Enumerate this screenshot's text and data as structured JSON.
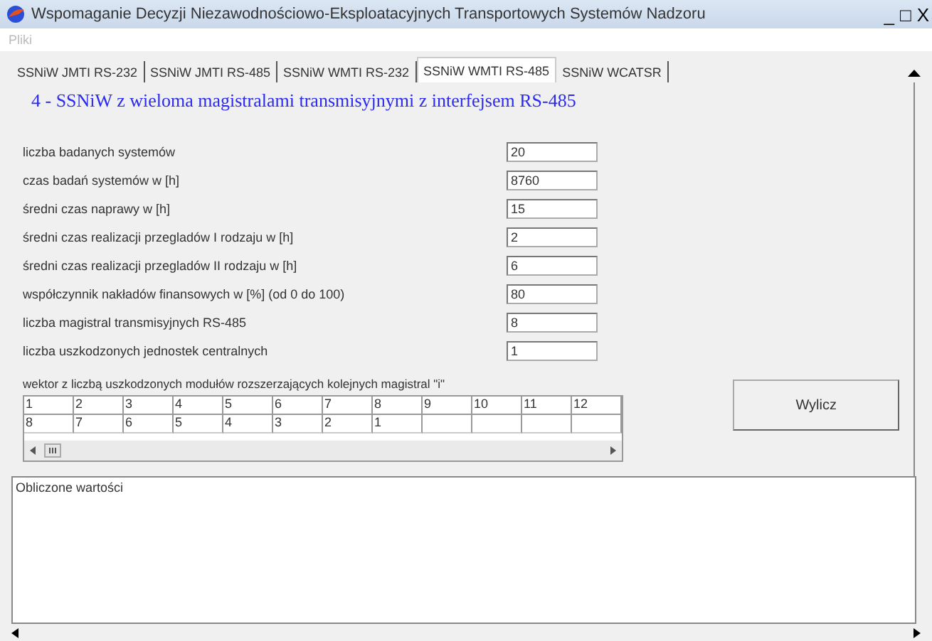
{
  "window": {
    "title": "Wspomaganie Decyzji Niezawodnościowo-Eksploatacyjnych Transportowych Systemów Nadzoru",
    "controls": [
      "_",
      "□",
      "X"
    ]
  },
  "menu": [
    {
      "label": "Pliki",
      "disabled": true
    }
  ],
  "tabs": [
    {
      "label": "SSNiW JMTI RS-232",
      "selected": false
    },
    {
      "label": "SSNiW JMTI RS-485",
      "selected": false
    },
    {
      "label": "SSNiW WMTI RS-232",
      "selected": false
    },
    {
      "label": "SSNiW WMTI RS-485",
      "selected": true
    },
    {
      "label": "SSNiW WCATSR",
      "selected": false
    }
  ],
  "heading": "4 - SSNiW z wieloma magistralami transmisyjnymi z interfejsem RS-485",
  "fields": [
    {
      "label": "liczba badanych systemów",
      "value": "20"
    },
    {
      "label": "czas badań systemów w [h]",
      "value": "8760"
    },
    {
      "label": "średni czas naprawy w [h]",
      "value": "15"
    },
    {
      "label": "średni czas realizacji przegladów I rodzaju w [h]",
      "value": "2"
    },
    {
      "label": "średni czas realizacji przegladów II rodzaju w [h]",
      "value": "6"
    },
    {
      "label": "współczynnik nakładów finansowych w [%] (od 0 do 100)",
      "value": "80"
    },
    {
      "label": "liczba magistral transmisyjnych RS-485",
      "value": "8"
    },
    {
      "label": "liczba uszkodzonych jednostek centralnych",
      "value": "1"
    }
  ],
  "vector": {
    "label": "wektor z liczbą uszkodzonych modułów rozszerzających kolejnych magistral \"i\"",
    "columns": [
      "1",
      "2",
      "3",
      "4",
      "5",
      "6",
      "7",
      "8",
      "9",
      "10",
      "11",
      "12"
    ],
    "values": [
      "8",
      "7",
      "6",
      "5",
      "4",
      "3",
      "2",
      "1"
    ]
  },
  "button": "Wylicz",
  "output": {
    "value": "Obliczone wartości"
  }
}
